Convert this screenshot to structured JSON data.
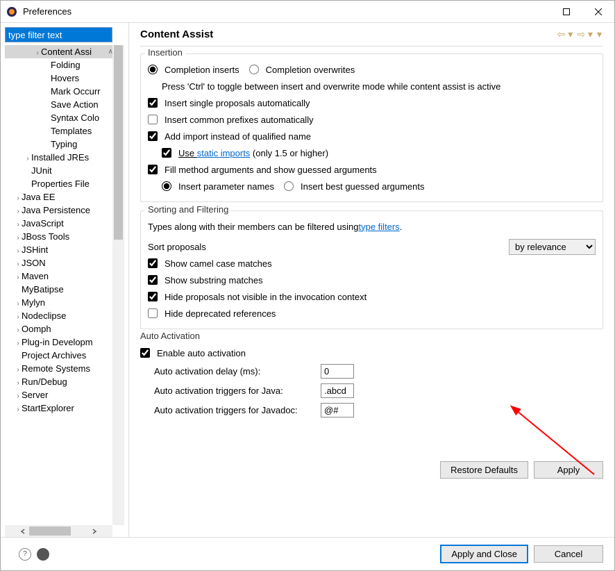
{
  "window": {
    "title": "Preferences"
  },
  "filter": {
    "text": "type filter text"
  },
  "tree": [
    {
      "label": "Content Assi",
      "caret": "›",
      "indent": 3,
      "selected": true,
      "up": true
    },
    {
      "label": "Folding",
      "caret": "",
      "indent": 4
    },
    {
      "label": "Hovers",
      "caret": "",
      "indent": 4
    },
    {
      "label": "Mark Occurr",
      "caret": "",
      "indent": 4
    },
    {
      "label": "Save Action",
      "caret": "",
      "indent": 4
    },
    {
      "label": "Syntax Colo",
      "caret": "",
      "indent": 4
    },
    {
      "label": "Templates",
      "caret": "",
      "indent": 4
    },
    {
      "label": "Typing",
      "caret": "",
      "indent": 4
    },
    {
      "label": "Installed JREs",
      "caret": "›",
      "indent": 2
    },
    {
      "label": "JUnit",
      "caret": "",
      "indent": 2
    },
    {
      "label": "Properties File",
      "caret": "",
      "indent": 2
    },
    {
      "label": "Java EE",
      "caret": "›",
      "indent": 1
    },
    {
      "label": "Java Persistence",
      "caret": "›",
      "indent": 1
    },
    {
      "label": "JavaScript",
      "caret": "›",
      "indent": 1
    },
    {
      "label": "JBoss Tools",
      "caret": "›",
      "indent": 1
    },
    {
      "label": "JSHint",
      "caret": "›",
      "indent": 1
    },
    {
      "label": "JSON",
      "caret": "›",
      "indent": 1
    },
    {
      "label": "Maven",
      "caret": "›",
      "indent": 1
    },
    {
      "label": "MyBatipse",
      "caret": "",
      "indent": 1
    },
    {
      "label": "Mylyn",
      "caret": "›",
      "indent": 1
    },
    {
      "label": "Nodeclipse",
      "caret": "›",
      "indent": 1
    },
    {
      "label": "Oomph",
      "caret": "›",
      "indent": 1
    },
    {
      "label": "Plug-in Developm",
      "caret": "›",
      "indent": 1
    },
    {
      "label": "Project Archives",
      "caret": "",
      "indent": 1
    },
    {
      "label": "Remote Systems",
      "caret": "›",
      "indent": 1
    },
    {
      "label": "Run/Debug",
      "caret": "›",
      "indent": 1
    },
    {
      "label": "Server",
      "caret": "›",
      "indent": 1
    },
    {
      "label": "StartExplorer",
      "caret": "›",
      "indent": 1
    }
  ],
  "header": {
    "title": "Content Assist"
  },
  "insertion": {
    "group_title": "Insertion",
    "completion_inserts": "Completion inserts",
    "completion_overwrites": "Completion overwrites",
    "press_ctrl": "Press 'Ctrl' to toggle between insert and overwrite mode while content assist is active",
    "insert_single": "Insert single proposals automatically",
    "insert_common": "Insert common prefixes automatically",
    "add_import": "Add import instead of qualified name",
    "use": "Use ",
    "static_imports": "static imports",
    "only_15": " (only 1.5 or higher)",
    "fill_method": "Fill method arguments and show guessed arguments",
    "insert_param_names": "Insert parameter names",
    "insert_best": "Insert best guessed arguments"
  },
  "sorting": {
    "group_title": "Sorting and Filtering",
    "types_along": "Types along with their members can be filtered using ",
    "type_filters": "type filters",
    "sort_proposals": "Sort proposals",
    "by_relevance": "by relevance",
    "show_camel": "Show camel case matches",
    "show_substring": "Show substring matches",
    "hide_proposals": "Hide proposals not visible in the invocation context",
    "hide_deprecated": "Hide deprecated references"
  },
  "auto": {
    "group_title": "Auto Activation",
    "enable": "Enable auto activation",
    "delay_label": "Auto activation delay (ms):",
    "delay_value": "0",
    "java_label": "Auto activation triggers for Java:",
    "java_value": ".abcd",
    "javadoc_label": "Auto activation triggers for Javadoc:",
    "javadoc_value": "@#"
  },
  "buttons": {
    "restore": "Restore Defaults",
    "apply": "Apply",
    "apply_close": "Apply and Close",
    "cancel": "Cancel"
  }
}
